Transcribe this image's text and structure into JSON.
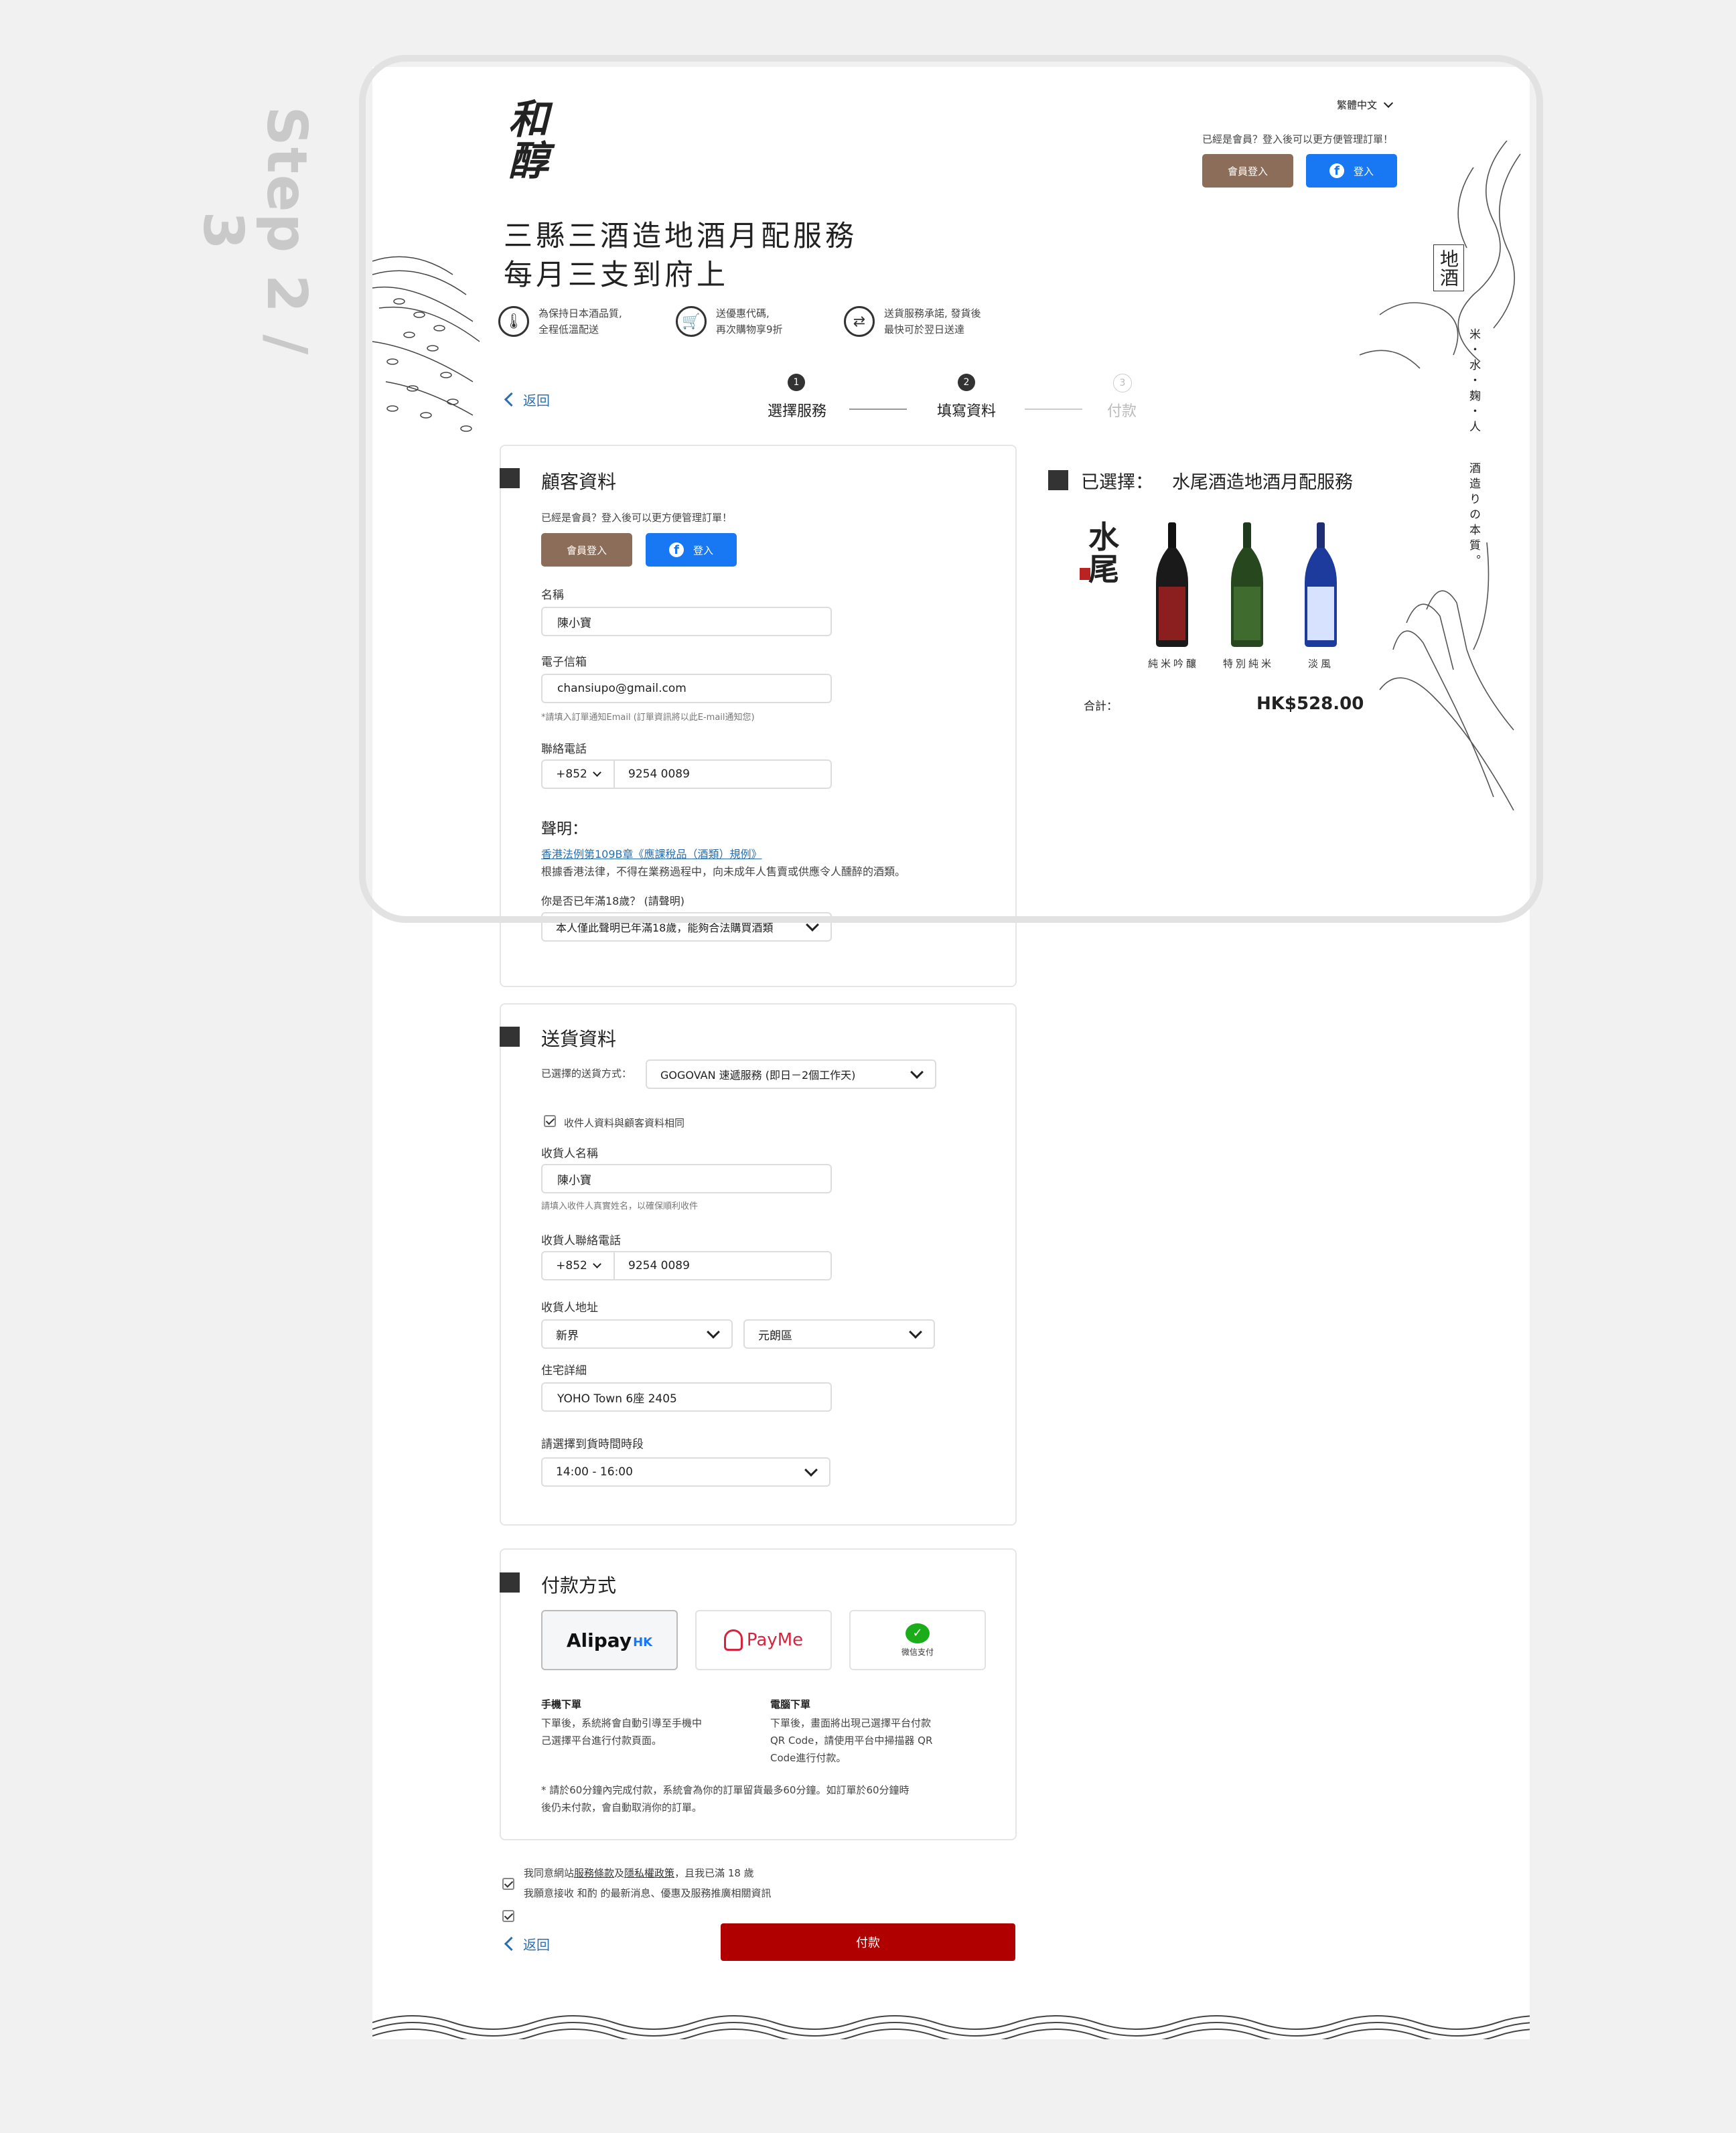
{
  "step_label": "Step 2 / 3",
  "header": {
    "logo": "和醇",
    "language": "繁體中文",
    "member_prompt": "已經是會員？登入後可以更方便管理訂單！",
    "member_login": "會員登入",
    "fb_login": "登入",
    "hero_line1": "三縣三酒造地酒月配服務",
    "hero_line2": "每月三支到府上",
    "deco_vertical_1": "地酒",
    "deco_vertical_2": "米・水・麹・人",
    "deco_vertical_3": "酒造りの本質。"
  },
  "features": [
    {
      "icon": "thermometer-icon",
      "line1": "為保持日本酒品質,",
      "line2": "全程低溫配送"
    },
    {
      "icon": "cart-icon",
      "line1": "送優惠代碼,",
      "line2": "再次購物享9折"
    },
    {
      "icon": "delivery-icon",
      "line1": "送貨服務承諾, 發貨後",
      "line2": "最快可於翌日送達"
    }
  ],
  "nav": {
    "back": "返回"
  },
  "steps": [
    {
      "num": "1",
      "label": "選擇服務"
    },
    {
      "num": "2",
      "label": "填寫資料"
    },
    {
      "num": "3",
      "label": "付款"
    }
  ],
  "customer": {
    "title": "顧客資料",
    "member_prompt": "已經是會員？登入後可以更方便管理訂單！",
    "member_login": "會員登入",
    "fb_login": "登入",
    "name_label": "名稱",
    "name_value": "陳小寶",
    "email_label": "電子信箱",
    "email_value": "chansiupo@gmail.com",
    "email_hint": "*請填入訂單通知Email (訂單資訊將以此E-mail通知您)",
    "phone_label": "聯絡電話",
    "phone_code": "+852",
    "phone_value": "9254 0089",
    "declaration_title": "聲明：",
    "declaration_link": "香港法例第109B章《應課稅品（酒類）規例》",
    "declaration_text": "根據香港法律，不得在業務過程中，向未成年人售賣或供應令人醺醉的酒類。",
    "age_question": "你是否已年滿18歲？ (請聲明)",
    "age_value": "本人僅此聲明已年滿18歲，能夠合法購買酒類"
  },
  "selected": {
    "title": "已選擇：",
    "plan": "水尾酒造地酒月配服務",
    "brand": "水尾",
    "bottles": [
      {
        "name": "純米吟釀",
        "color": "#8b1e1e"
      },
      {
        "name": "特別純米",
        "color": "#3f6b2f"
      },
      {
        "name": "淡風",
        "color": "#2d4fa8"
      }
    ],
    "total_label": "合計：",
    "total_value": "HK$528.00"
  },
  "delivery": {
    "title": "送貨資料",
    "method_label": "已選擇的送貨方式：",
    "method_value": "GOGOVAN 速遞服務 (即日－2個工作天)",
    "same_as_customer": "收件人資料與顧客資料相同",
    "recipient_label": "收貨人名稱",
    "recipient_value": "陳小寶",
    "recipient_hint": "請填入收件人真實姓名，以確保順利收件",
    "phone_label": "收貨人聯絡電話",
    "phone_code": "+852",
    "phone_value": "9254 0089",
    "address_label": "收貨人地址",
    "region_value": "新界",
    "district_value": "元朗區",
    "detail_label": "住宅詳細",
    "detail_value": "YOHO Town 6座 2405",
    "time_label": "請選擇到貨時間時段",
    "time_value": "14:00 - 16:00"
  },
  "payment": {
    "title": "付款方式",
    "methods": [
      "Alipay",
      "HK",
      "PayMe",
      "微信支付"
    ],
    "mobile_title": "手機下單",
    "mobile_text1": "下單後，系統將會自動引導至手機中",
    "mobile_text2": "己選擇平台進行付款頁面。",
    "desktop_title": "電腦下單",
    "desktop_text1": "下單後，畫面將出現己選擇平台付款",
    "desktop_text2": "QR Code，請使用平台中掃描器 QR",
    "desktop_text3": "Code進行付款。",
    "note1": "* 請於60分鐘內完成付款，系統會為你的訂單留貨最多60分鐘。如訂單於60分鐘時",
    "note2": "後仍未付款，會自動取消你的訂單。"
  },
  "agreements": {
    "terms_prefix": "我同意網站",
    "terms_link1": "服務條款",
    "terms_and": "及",
    "terms_link2": "隱私權政策",
    "terms_suffix": "，且我已滿 18 歲",
    "marketing": "我願意接收 和酌 的最新消息、優惠及服務推廣相關資訊"
  },
  "footer": {
    "back": "返回",
    "pay": "付款"
  },
  "colors": {
    "brand_brown": "#8b6d5a",
    "facebook": "#1877f2",
    "pay_red": "#b00000",
    "link_blue": "#2a6fb0"
  }
}
